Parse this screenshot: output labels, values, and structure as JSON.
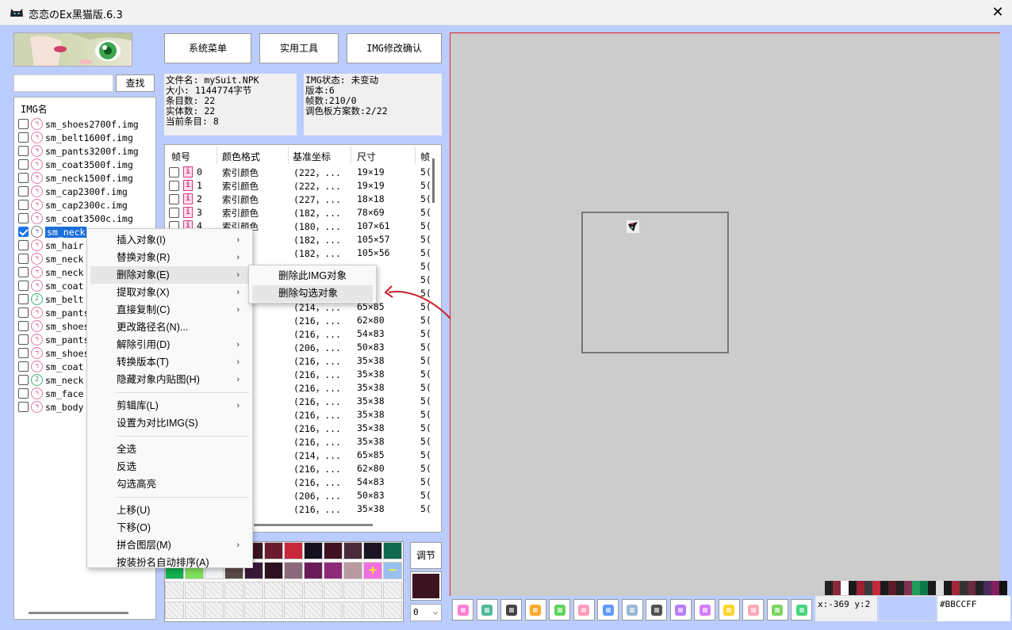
{
  "window": {
    "title": "恋恋のEx黑猫版.6.3",
    "close_glyph": "✕"
  },
  "search": {
    "value": "",
    "button": "查找"
  },
  "img_list": {
    "header": "IMG名",
    "items": [
      {
        "name": "sm_shoes2700f.img",
        "checked": false,
        "icon": "cat-pink",
        "selected": false
      },
      {
        "name": "sm_belt1600f.img",
        "checked": false,
        "icon": "cat-pink",
        "selected": false
      },
      {
        "name": "sm_pants3200f.img",
        "checked": false,
        "icon": "cat-pink",
        "selected": false
      },
      {
        "name": "sm_coat3500f.img",
        "checked": false,
        "icon": "cat-pink",
        "selected": false
      },
      {
        "name": "sm_neck1500f.img",
        "checked": false,
        "icon": "cat-pink",
        "selected": false
      },
      {
        "name": "sm_cap2300f.img",
        "checked": false,
        "icon": "cat-pink",
        "selected": false
      },
      {
        "name": "sm_cap2300c.img",
        "checked": false,
        "icon": "cat-pink",
        "selected": false
      },
      {
        "name": "sm_coat3500c.img",
        "checked": false,
        "icon": "cat-pink",
        "selected": false
      },
      {
        "name": "sm_neck",
        "checked": true,
        "icon": "cat-gray",
        "selected": true
      },
      {
        "name": "sm_hair",
        "checked": false,
        "icon": "cat-pink",
        "selected": false
      },
      {
        "name": "sm_neck",
        "checked": false,
        "icon": "cat-pink",
        "selected": false
      },
      {
        "name": "sm_neck",
        "checked": false,
        "icon": "cat-pink",
        "selected": false
      },
      {
        "name": "sm_coat",
        "checked": false,
        "icon": "cat-pink",
        "selected": false
      },
      {
        "name": "sm_belt",
        "checked": false,
        "icon": "cat-green",
        "selected": false
      },
      {
        "name": "sm_pants",
        "checked": false,
        "icon": "cat-pink",
        "selected": false
      },
      {
        "name": "sm_shoes",
        "checked": false,
        "icon": "cat-pink",
        "selected": false
      },
      {
        "name": "sm_pants",
        "checked": false,
        "icon": "cat-pink",
        "selected": false
      },
      {
        "name": "sm_shoes",
        "checked": false,
        "icon": "cat-pink",
        "selected": false
      },
      {
        "name": "sm_coat",
        "checked": false,
        "icon": "cat-pink",
        "selected": false
      },
      {
        "name": "sm_neck",
        "checked": false,
        "icon": "cat-green",
        "selected": false
      },
      {
        "name": "sm_face",
        "checked": false,
        "icon": "cat-pink",
        "selected": false
      },
      {
        "name": "sm_body",
        "checked": false,
        "icon": "cat-pink",
        "selected": false
      }
    ]
  },
  "top_buttons": {
    "system_menu": "系统菜单",
    "tools": "实用工具",
    "img_confirm": "IMG修改确认"
  },
  "file_info": {
    "filename": "文件名: mySuit.NPK",
    "size": "大小: 1144774字节",
    "entries": "条目数: 22",
    "entities": "实体数: 22",
    "current": "当前条目: 8"
  },
  "img_info": {
    "status": "IMG状态: 未变动",
    "version": "版本:6",
    "frames": "帧数:210/0",
    "palettes": "调色板方案数:2/22"
  },
  "frame_table": {
    "columns": [
      "帧号",
      "颜色格式",
      "基准坐标",
      "尺寸",
      "帧"
    ],
    "rows": [
      {
        "idx": "0",
        "fmt": "索引颜色",
        "coord": "(222，...",
        "size": "19×19",
        "extra": "5("
      },
      {
        "idx": "1",
        "fmt": "索引颜色",
        "coord": "(222，...",
        "size": "19×19",
        "extra": "5("
      },
      {
        "idx": "2",
        "fmt": "索引颜色",
        "coord": "(227，...",
        "size": "18×18",
        "extra": "5("
      },
      {
        "idx": "3",
        "fmt": "索引颜色",
        "coord": "(182，...",
        "size": "78×69",
        "extra": "5("
      },
      {
        "idx": "4",
        "fmt": "索引颜色",
        "coord": "(180，...",
        "size": "107×61",
        "extra": "5("
      },
      {
        "idx": "",
        "fmt": "色",
        "coord": "(182，...",
        "size": "105×57",
        "extra": "5("
      },
      {
        "idx": "",
        "fmt": "色",
        "coord": "(182，...",
        "size": "105×56",
        "extra": "5("
      },
      {
        "idx": "",
        "fmt": "色",
        "coord": "",
        "size": "",
        "extra": "5("
      },
      {
        "idx": "",
        "fmt": "色",
        "coord": "",
        "size": "",
        "extra": "5("
      },
      {
        "idx": "",
        "fmt": "色",
        "coord": "",
        "size": "",
        "extra": "5("
      },
      {
        "idx": "",
        "fmt": "色",
        "coord": "(214，...",
        "size": "65×85",
        "extra": "5("
      },
      {
        "idx": "",
        "fmt": "色",
        "coord": "(216，...",
        "size": "62×80",
        "extra": "5("
      },
      {
        "idx": "",
        "fmt": "色",
        "coord": "(216，...",
        "size": "54×83",
        "extra": "5("
      },
      {
        "idx": "",
        "fmt": "色",
        "coord": "(206，...",
        "size": "50×83",
        "extra": "5("
      },
      {
        "idx": "",
        "fmt": "色",
        "coord": "(216，...",
        "size": "35×38",
        "extra": "5("
      },
      {
        "idx": "",
        "fmt": "色",
        "coord": "(216，...",
        "size": "35×38",
        "extra": "5("
      },
      {
        "idx": "",
        "fmt": "色",
        "coord": "(216，...",
        "size": "35×38",
        "extra": "5("
      },
      {
        "idx": "",
        "fmt": "色",
        "coord": "(216，...",
        "size": "35×38",
        "extra": "5("
      },
      {
        "idx": "",
        "fmt": "色",
        "coord": "(216，...",
        "size": "35×38",
        "extra": "5("
      },
      {
        "idx": "",
        "fmt": "色",
        "coord": "(216，...",
        "size": "35×38",
        "extra": "5("
      },
      {
        "idx": "",
        "fmt": "色",
        "coord": "(216，...",
        "size": "35×38",
        "extra": "5("
      },
      {
        "idx": "",
        "fmt": "色",
        "coord": "(214，...",
        "size": "65×85",
        "extra": "5("
      },
      {
        "idx": "",
        "fmt": "色",
        "coord": "(216，...",
        "size": "62×80",
        "extra": "5("
      },
      {
        "idx": "",
        "fmt": "色",
        "coord": "(216，...",
        "size": "54×83",
        "extra": "5("
      },
      {
        "idx": "",
        "fmt": "色",
        "coord": "(206，...",
        "size": "50×83",
        "extra": "5("
      },
      {
        "idx": "",
        "fmt": "色",
        "coord": "(216，...",
        "size": "35×38",
        "extra": "5("
      }
    ]
  },
  "context_menu": {
    "items": [
      {
        "label": "插入对象(I)",
        "submenu": true
      },
      {
        "label": "替换对象(R)",
        "submenu": true
      },
      {
        "label": "删除对象(E)",
        "submenu": true,
        "highlighted": true
      },
      {
        "label": "提取对象(X)",
        "submenu": true
      },
      {
        "label": "直接复制(C)",
        "submenu": true
      },
      {
        "label": "更改路径名(N)...",
        "submenu": false
      },
      {
        "label": "解除引用(D)",
        "submenu": true
      },
      {
        "label": "转换版本(T)",
        "submenu": true
      },
      {
        "label": "隐藏对象内贴图(H)",
        "submenu": true
      },
      {
        "sep": true
      },
      {
        "label": "剪辑库(L)",
        "submenu": true
      },
      {
        "label": "设置为对比IMG(S)",
        "submenu": false
      },
      {
        "sep": true
      },
      {
        "label": "全选",
        "submenu": false
      },
      {
        "label": "反选",
        "submenu": false
      },
      {
        "label": "勾选高亮",
        "submenu": false
      },
      {
        "sep": true
      },
      {
        "label": "上移(U)",
        "submenu": false
      },
      {
        "label": "下移(O)",
        "submenu": false
      },
      {
        "label": "拼合图层(M)",
        "submenu": true
      },
      {
        "label": "按装扮名自动排序(A)",
        "submenu": false
      }
    ]
  },
  "sub_menu": {
    "items": [
      {
        "label": "删除此IMG对象",
        "highlighted": false
      },
      {
        "label": "删除勾选对象",
        "highlighted": true
      }
    ]
  },
  "palette": {
    "swatches": [
      "#3a1420",
      "#6b1b2e",
      "#c8283c",
      "#14101e",
      "#3e1222",
      "#4b2a3a",
      "#1c1422",
      "#0f6a4f",
      "#12b050",
      "#7fe05a",
      "#f0f4f4",
      "#5a4a48",
      "#3a1838",
      "#2c1020",
      "#8a6a7a",
      "#6a1c5a",
      "#8e2a78",
      "#b89aa0",
      "#0c0c0c"
    ],
    "plus_color": "#f070e0",
    "minus_color": "#9ac0f0",
    "adjust_label": "调节",
    "current_color": "#3b1321",
    "select_value": "0"
  },
  "canvas": {
    "bg": "#cccccc"
  },
  "toolbar": {
    "tools": [
      "frame-icon",
      "palette-grid-icon",
      "film-icon",
      "cat-face-icon",
      "camera-icon",
      "cloud-icon",
      "magnifier-icon",
      "move-icon",
      "crop-icon",
      "pencil-icon",
      "line-icon",
      "rectangle-icon",
      "eraser-icon",
      "eyedropper-icon",
      "tag-icon"
    ]
  },
  "status": {
    "coords": "x:-369 y:2",
    "hex": "#BBCCFF"
  },
  "color_strip": [
    "#222",
    "#8a2a3a",
    "#fff",
    "#1a1a1a",
    "#9a2232",
    "#3a3a3a",
    "#c02a3a",
    "#1a1a1a",
    "#5a1a2a",
    "#222",
    "#803050",
    "#1e9e5a",
    "#0e7a4a",
    "#1a1a1a",
    "#ddd",
    "#1a1a1a",
    "#a02838",
    "#333",
    "#6a2a40",
    "#222",
    "#4a2a5a",
    "#802060",
    "#111"
  ]
}
